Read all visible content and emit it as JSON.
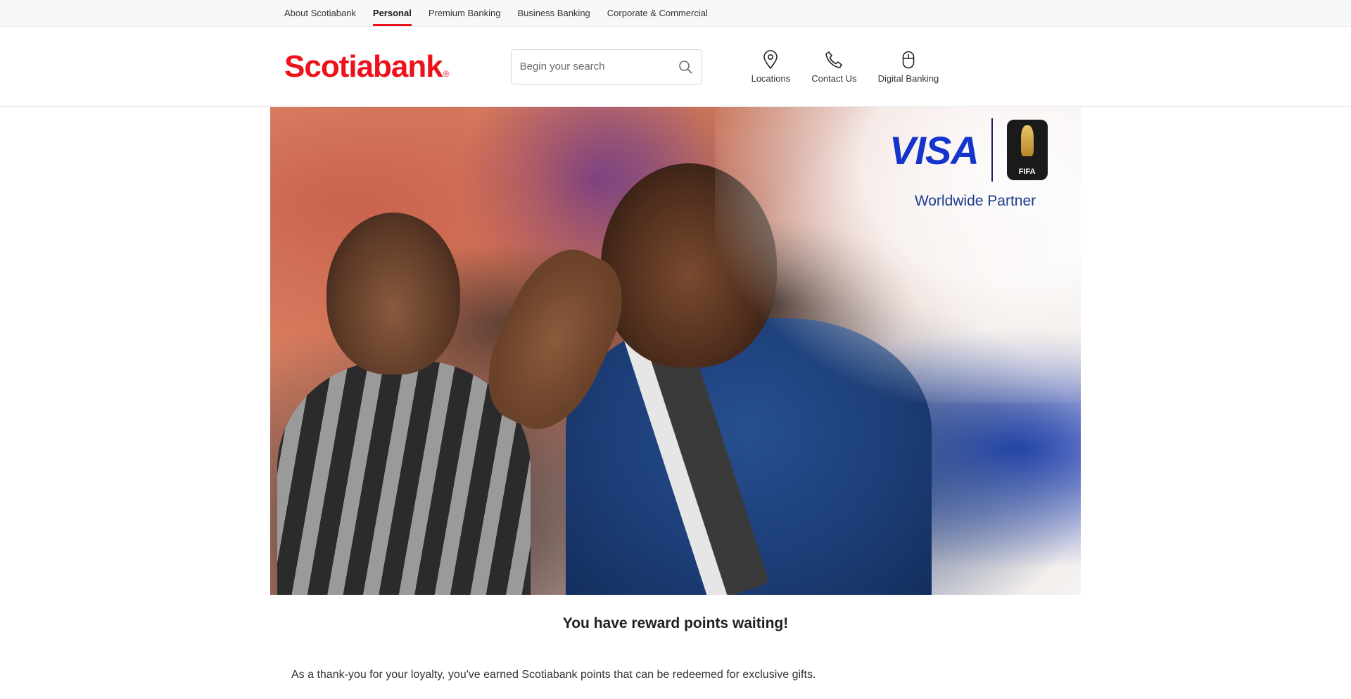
{
  "topnav": {
    "items": [
      {
        "label": "About Scotiabank",
        "active": false
      },
      {
        "label": "Personal",
        "active": true
      },
      {
        "label": "Premium Banking",
        "active": false
      },
      {
        "label": "Business Banking",
        "active": false
      },
      {
        "label": "Corporate & Commercial",
        "active": false
      }
    ]
  },
  "header": {
    "logo_text": "Scotiabank",
    "logo_mark": "®",
    "search": {
      "placeholder": "Begin your search",
      "icon": "search-icon"
    },
    "utility": [
      {
        "label": "Locations",
        "icon": "location-pin-icon"
      },
      {
        "label": "Contact Us",
        "icon": "phone-icon"
      },
      {
        "label": "Digital Banking",
        "icon": "mouse-icon"
      }
    ]
  },
  "hero": {
    "partner_brand": "VISA",
    "badge_text": "FIFA",
    "partner_caption": "Worldwide Partner"
  },
  "main": {
    "reward_icon": "",
    "reward_title": "You have reward points waiting!",
    "intro_text": "As a thank-you for your loyalty, you've earned Scotiabank points that can be redeemed for exclusive gifts."
  },
  "colors": {
    "brand_red": "#ec111a",
    "visa_blue": "#1434cb",
    "partner_navy": "#1a3c8e"
  }
}
